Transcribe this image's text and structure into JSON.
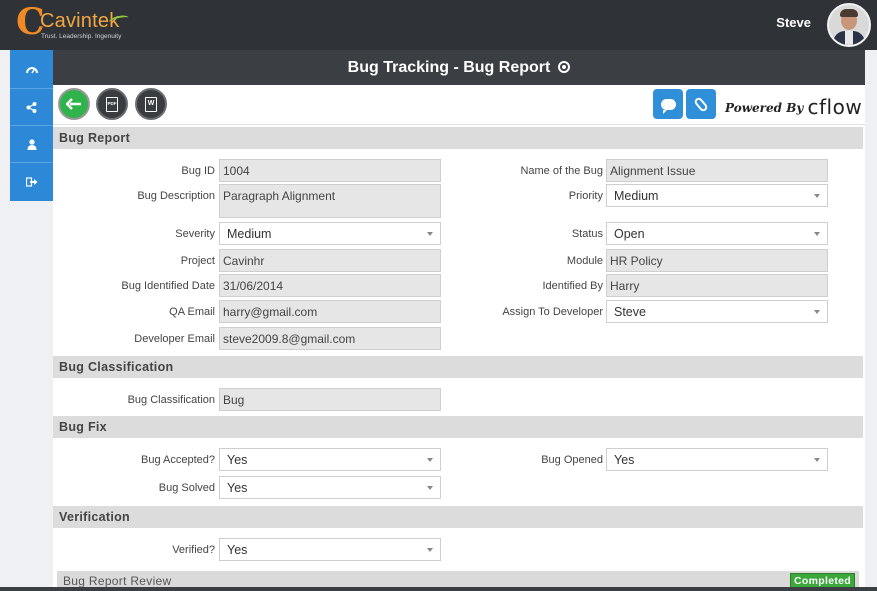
{
  "app": {
    "logo_text": "Cavintek",
    "logo_tagline": "Trust. Leadership. Ingenuity",
    "user_name": "Steve"
  },
  "sidebar": {
    "items": [
      {
        "icon": "dashboard-icon"
      },
      {
        "icon": "share-icon"
      },
      {
        "icon": "user-icon"
      },
      {
        "icon": "logout-icon"
      }
    ]
  },
  "page": {
    "title": "Bug Tracking - Bug Report",
    "powered_by": "Powered By",
    "powered_brand": "cflow"
  },
  "toolbar": {
    "back_icon": "arrow-left-icon",
    "pdf_glyph": "PDF",
    "word_glyph": "W"
  },
  "sections": {
    "bug_report": "Bug Report",
    "bug_classification": "Bug Classification",
    "bug_fix": "Bug Fix",
    "verification": "Verification",
    "review": "Bug Report Review"
  },
  "bug_report": {
    "bug_id_label": "Bug ID",
    "bug_id": "1004",
    "name_label": "Name of the Bug",
    "name": "Alignment Issue",
    "description_label": "Bug Description",
    "description": "Paragraph Alignment",
    "priority_label": "Priority",
    "priority": "Medium",
    "severity_label": "Severity",
    "severity": "Medium",
    "status_label": "Status",
    "status": "Open",
    "project_label": "Project",
    "project": "Cavinhr",
    "module_label": "Module",
    "module": "HR Policy",
    "identified_date_label": "Bug Identified Date",
    "identified_date": "31/06/2014",
    "identified_by_label": "Identified By",
    "identified_by": "Harry",
    "qa_email_label": "QA Email",
    "qa_email": "harry@gmail.com",
    "assign_label": "Assign To Developer",
    "assign": "Steve",
    "dev_email_label": "Developer Email",
    "dev_email": "steve2009.8@gmail.com"
  },
  "bug_classification": {
    "label": "Bug Classification",
    "value": "Bug"
  },
  "bug_fix": {
    "accepted_label": "Bug Accepted?",
    "accepted": "Yes",
    "opened_label": "Bug Opened",
    "opened": "Yes",
    "solved_label": "Bug Solved",
    "solved": "Yes"
  },
  "verification": {
    "verified_label": "Verified?",
    "verified": "Yes"
  },
  "review": {
    "status_badge": "Completed",
    "badge_color": "#3aa83a"
  },
  "colors": {
    "accent": "#2d89d8",
    "topbar": "#2f3337",
    "back_button": "#2fb34a",
    "logo": "#f08a24"
  }
}
